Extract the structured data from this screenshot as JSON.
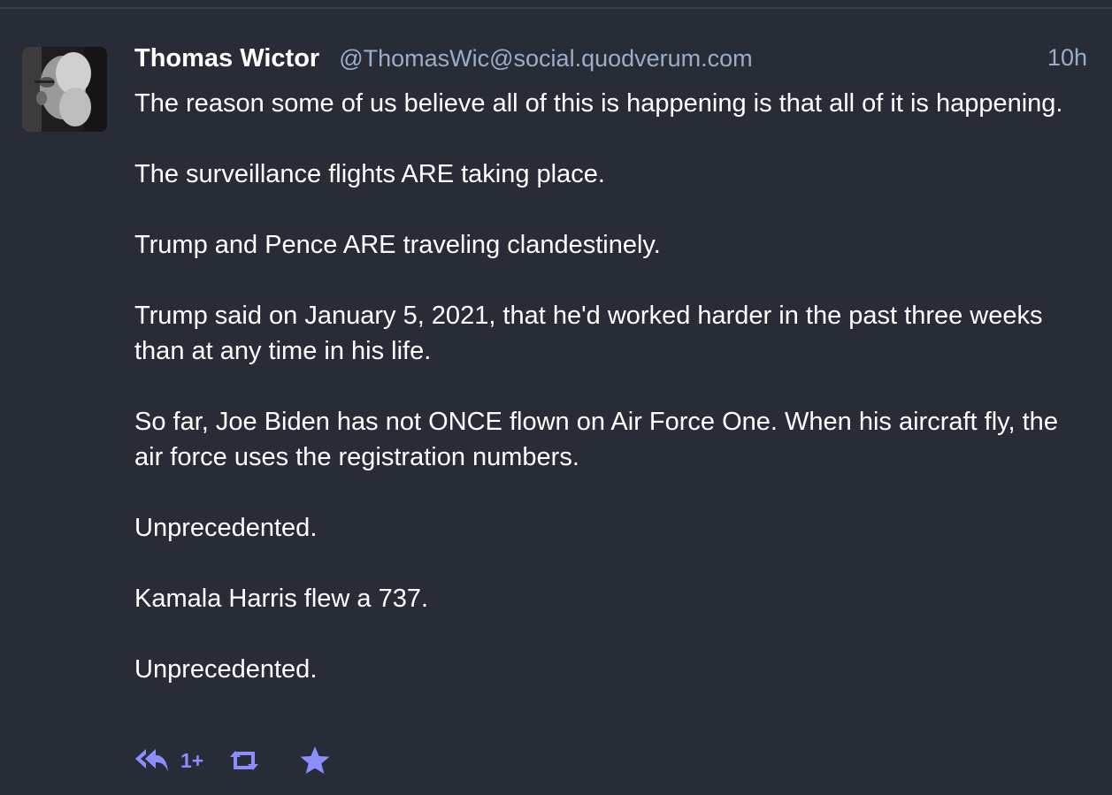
{
  "status": {
    "display_name": "Thomas Wictor",
    "handle": "@ThomasWic@social.quodverum.com",
    "timestamp": "10h",
    "paragraphs": [
      "The reason some of us believe all of this is happening is that all of it is happening.",
      "The surveillance flights ARE taking place.",
      "Trump and Pence ARE traveling clandestinely.",
      "Trump said on January 5, 2021, that he'd worked harder in the past three weeks than at any time in his life.",
      "So far, Joe Biden has not ONCE flown on Air Force One. When his aircraft fly, the air force uses the registration numbers.",
      "Unprecedented.",
      "Kamala Harris flew a 737.",
      "Unprecedented."
    ]
  },
  "actions": {
    "reply_count": "1+",
    "reply_icon": "reply-all-icon",
    "boost_icon": "retweet-icon",
    "favourite_icon": "star-icon"
  },
  "colors": {
    "background": "#282c37",
    "handle": "#9baec8",
    "action": "#8c8dff",
    "text": "#ffffff"
  }
}
